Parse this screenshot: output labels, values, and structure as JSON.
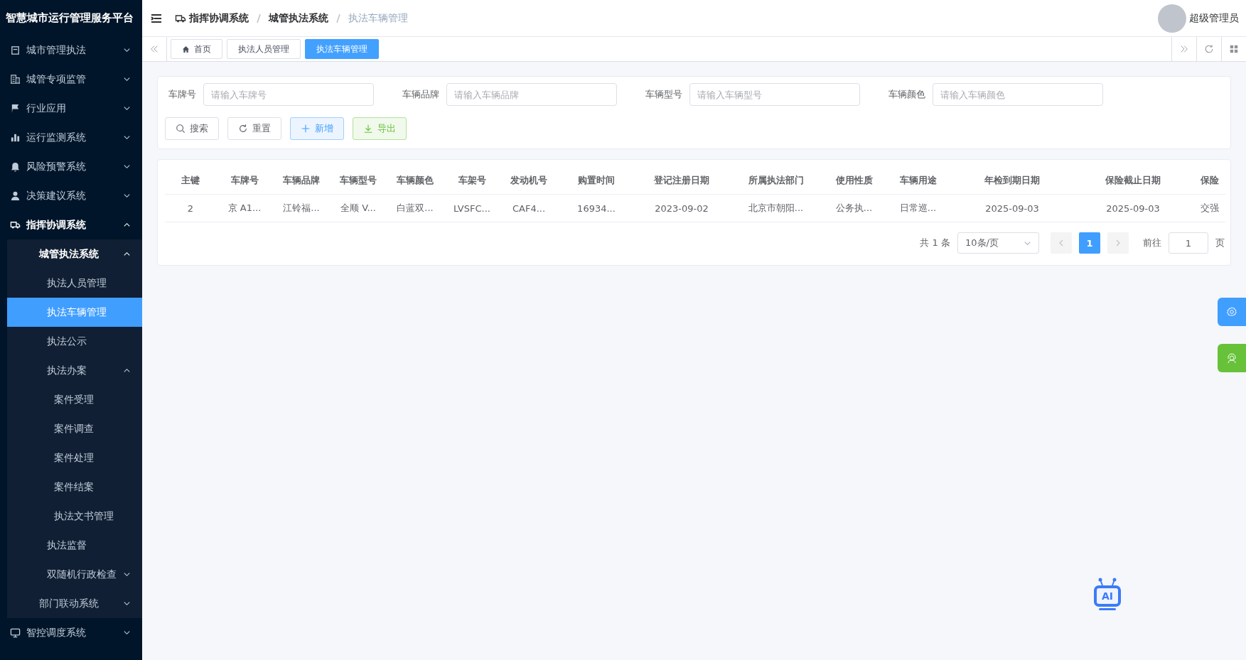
{
  "sidebar": {
    "title": "智慧城市运行管理服务平台",
    "items": [
      {
        "label": "城市管理执法",
        "expanded": false,
        "selected": false
      },
      {
        "label": "城管专项监管",
        "expanded": false,
        "selected": false
      },
      {
        "label": "行业应用",
        "expanded": false,
        "selected": false
      },
      {
        "label": "运行监测系统",
        "expanded": false,
        "selected": false
      },
      {
        "label": "风险预警系统",
        "expanded": false,
        "selected": false
      },
      {
        "label": "决策建议系统",
        "expanded": false,
        "selected": false
      },
      {
        "label": "指挥协调系统",
        "expanded": true,
        "selected": false,
        "children": [
          {
            "label": "城管执法系统",
            "expanded": true,
            "selected": false,
            "children": [
              {
                "label": "执法人员管理",
                "selected": false
              },
              {
                "label": "执法车辆管理",
                "selected": true
              },
              {
                "label": "执法公示",
                "selected": false
              },
              {
                "label": "执法办案",
                "expanded": true,
                "selected": false,
                "children": [
                  {
                    "label": "案件受理",
                    "selected": false
                  },
                  {
                    "label": "案件调查",
                    "selected": false
                  },
                  {
                    "label": "案件处理",
                    "selected": false
                  },
                  {
                    "label": "案件结案",
                    "selected": false
                  },
                  {
                    "label": "执法文书管理",
                    "selected": false
                  }
                ]
              },
              {
                "label": "执法监督",
                "selected": false
              },
              {
                "label": "双随机行政检查",
                "expanded": false,
                "selected": false
              }
            ]
          },
          {
            "label": "部门联动系统",
            "expanded": false,
            "selected": false
          }
        ]
      },
      {
        "label": "智控调度系统",
        "expanded": false,
        "selected": false
      }
    ]
  },
  "header": {
    "breadcrumb": [
      "指挥协调系统",
      "城管执法系统",
      "执法车辆管理"
    ],
    "user": "超级管理员"
  },
  "tabs": [
    {
      "label": "首页",
      "selected": false
    },
    {
      "label": "执法人员管理",
      "selected": false
    },
    {
      "label": "执法车辆管理",
      "selected": true
    }
  ],
  "filters": [
    {
      "label": "车牌号",
      "placeholder": "请输入车牌号"
    },
    {
      "label": "车辆品牌",
      "placeholder": "请输入车辆品牌"
    },
    {
      "label": "车辆型号",
      "placeholder": "请输入车辆型号"
    },
    {
      "label": "车辆颜色",
      "placeholder": "请输入车辆颜色"
    }
  ],
  "actions": [
    {
      "label": "搜索",
      "kind": "search"
    },
    {
      "label": "重置",
      "kind": "reset"
    },
    {
      "label": "新增",
      "kind": "add"
    },
    {
      "label": "导出",
      "kind": "export"
    }
  ],
  "table": {
    "columns": [
      "主键",
      "车牌号",
      "车辆品牌",
      "车辆型号",
      "车辆颜色",
      "车架号",
      "发动机号",
      "购置时间",
      "登记注册日期",
      "所属执法部门",
      "使用性质",
      "车辆用途",
      "年检到期日期",
      "保险截止日期",
      "保险"
    ],
    "rows": [
      [
        "2",
        "京 A1...",
        "江铃福...",
        "全顺 V...",
        "白蓝双...",
        "LVSFC...",
        "CAF4...",
        "16934...",
        "2023-09-02",
        "北京市朝阳...",
        "公务执...",
        "日常巡...",
        "2025-09-03",
        "2025-09-03",
        "交强"
      ]
    ]
  },
  "pagination": {
    "total": "共 1 条",
    "page_size": "10条/页",
    "pages": [
      {
        "label": "1",
        "selected": true
      }
    ],
    "goto_label": "前往",
    "goto_value": "1",
    "goto_suffix": "页"
  },
  "ai_assistant": {
    "label": "AI"
  }
}
